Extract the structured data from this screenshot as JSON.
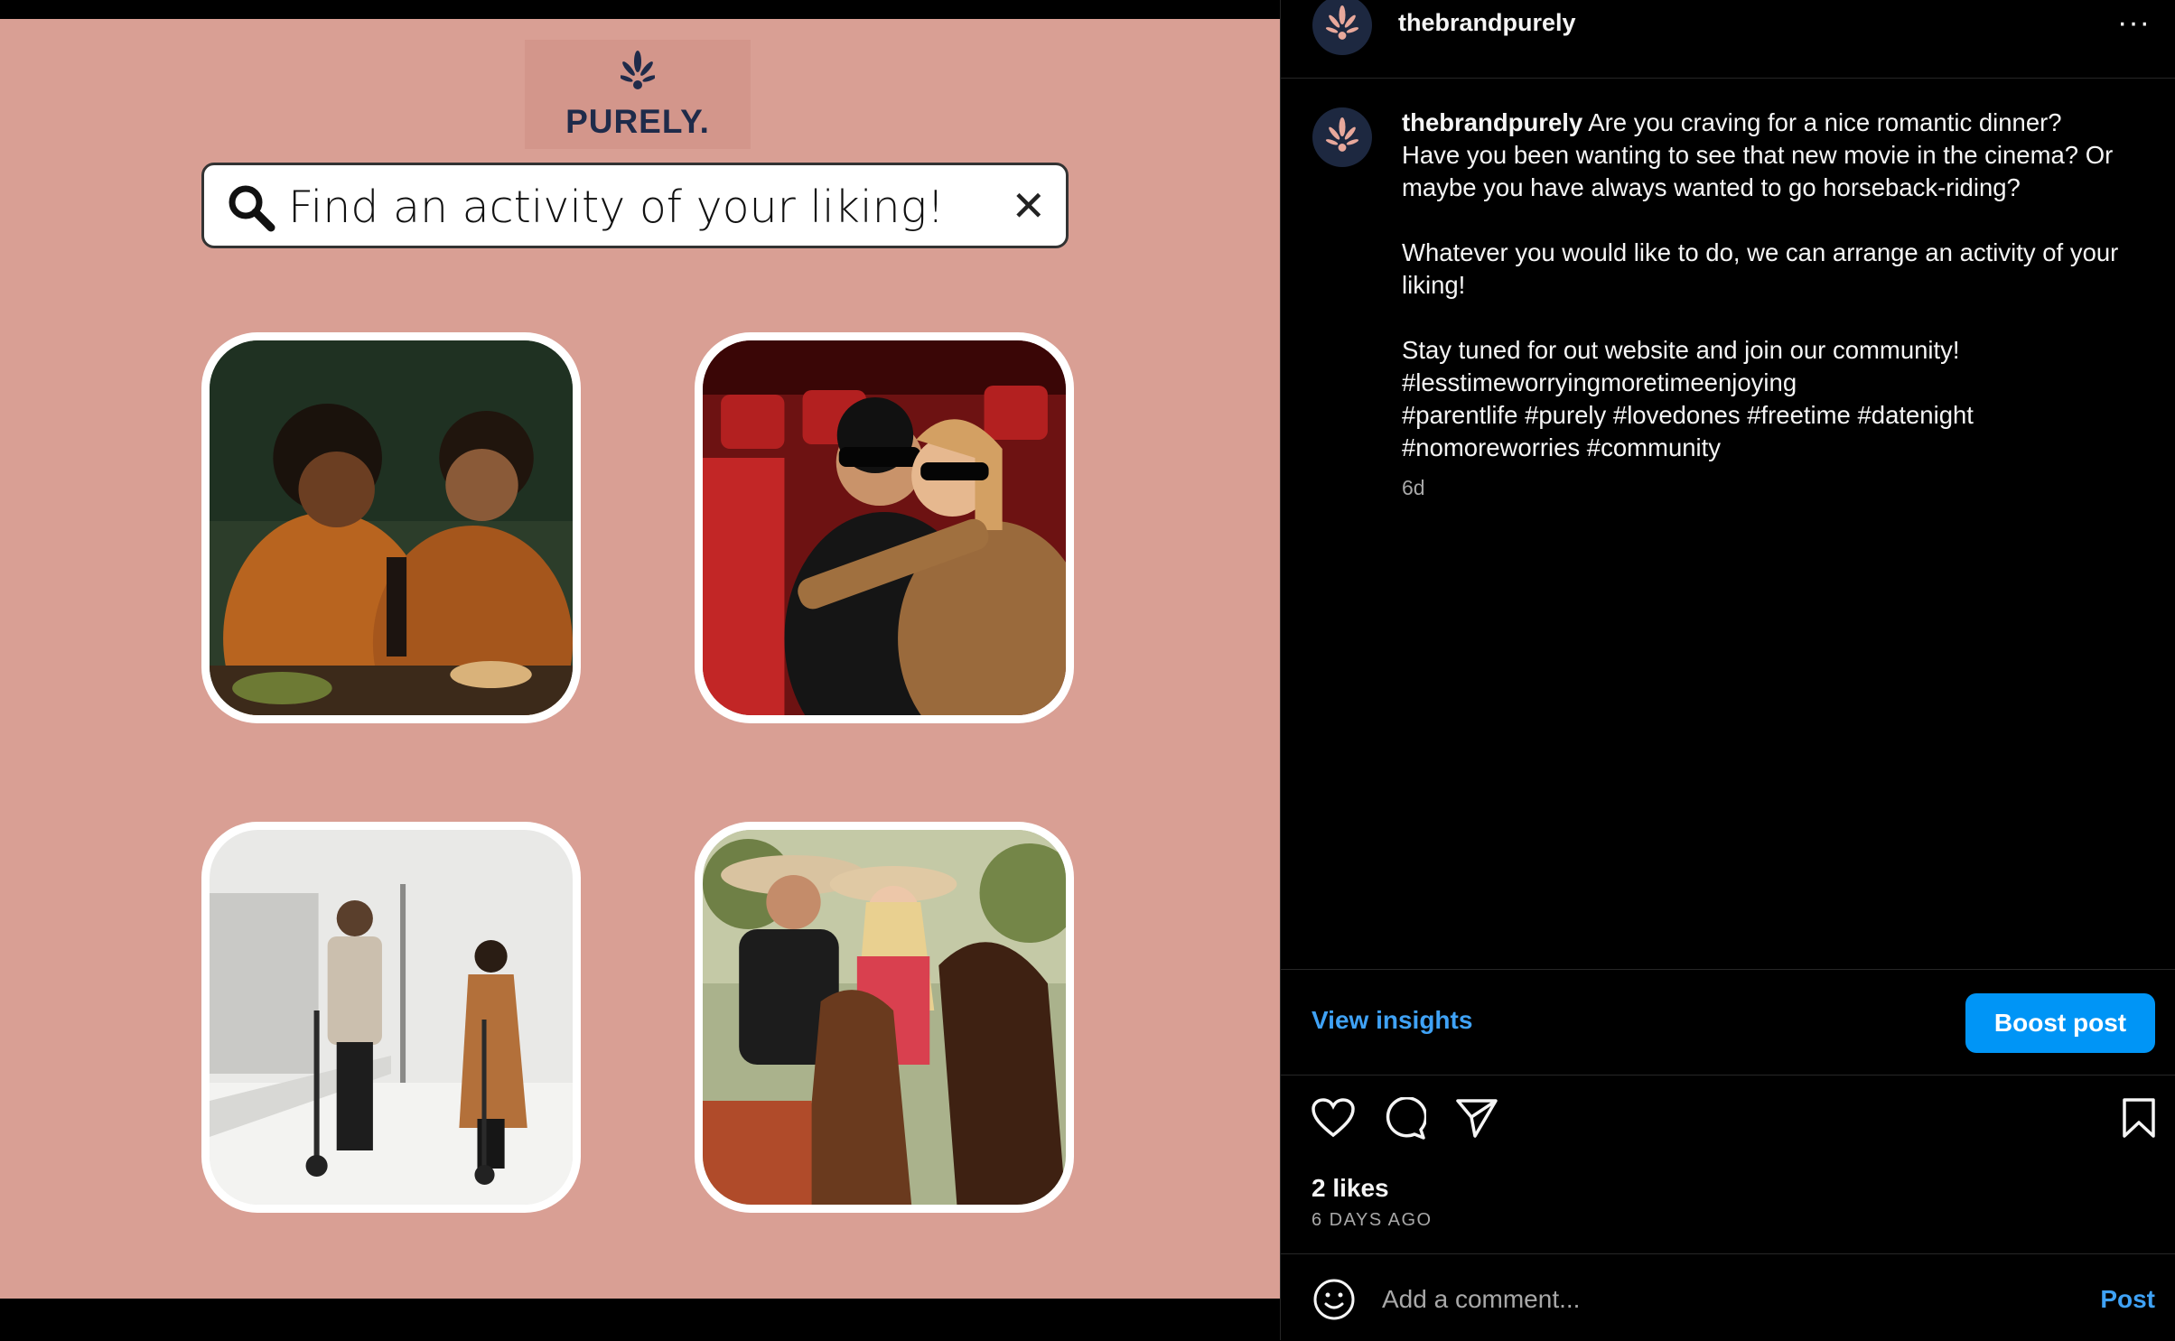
{
  "media": {
    "logo_text": "PURELY.",
    "search_text": "Find an activity of your liking!",
    "close_glyph": "✕",
    "colors": {
      "background": "#d99f94",
      "logo_box": "#d3968b",
      "logo_navy": "#1f2b4a"
    }
  },
  "header": {
    "username": "thebrandpurely",
    "more_glyph": "···"
  },
  "caption": {
    "username": "thebrandpurely",
    "text": " Are you craving for a nice romantic dinner? Have you been wanting to see that new movie in the cinema? Or maybe you have always wanted to go horseback-riding?\n\nWhatever you would like to do, we can arrange an activity of your liking!\n\nStay tuned for out website and join our community!\n#lesstimeworryingmoretimeenjoying\n#parentlife #purely #lovedones #freetime #datenight\n#nomoreworries #community",
    "age": "6d"
  },
  "insights": {
    "view_label": "View insights",
    "boost_label": "Boost post"
  },
  "actions": {
    "icons": [
      "heart-icon",
      "comment-icon",
      "share-icon",
      "bookmark-icon"
    ],
    "likes": "2 likes",
    "days_ago": "6 DAYS AGO"
  },
  "comment": {
    "placeholder": "Add a comment...",
    "post_label": "Post"
  },
  "colors": {
    "accent": "#0095f6",
    "link": "#3fa2f6",
    "muted": "#a8a8a8",
    "avatar_bg": "#1d2840"
  }
}
